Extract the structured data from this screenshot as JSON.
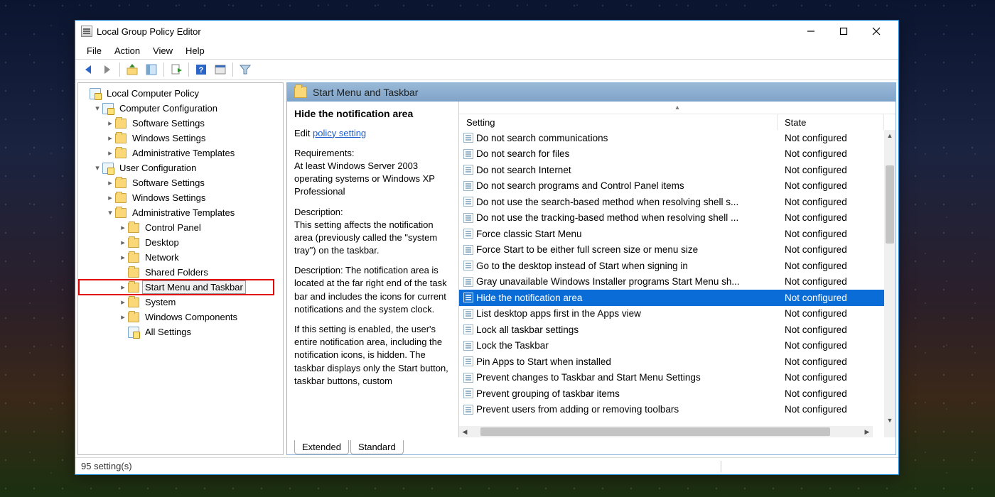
{
  "window": {
    "title": "Local Group Policy Editor"
  },
  "menu": {
    "file": "File",
    "action": "Action",
    "view": "View",
    "help": "Help"
  },
  "tree": {
    "root": "Local Computer Policy",
    "cc": "Computer Configuration",
    "cc_software": "Software Settings",
    "cc_windows": "Windows Settings",
    "cc_admin": "Administrative Templates",
    "uc": "User Configuration",
    "uc_software": "Software Settings",
    "uc_windows": "Windows Settings",
    "uc_admin": "Administrative Templates",
    "uc_cp": "Control Panel",
    "uc_desktop": "Desktop",
    "uc_network": "Network",
    "uc_shared": "Shared Folders",
    "uc_start": "Start Menu and Taskbar",
    "uc_system": "System",
    "uc_wincomp": "Windows Components",
    "uc_all": "All Settings"
  },
  "pane": {
    "header": "Start Menu and Taskbar",
    "desc_title": "Hide the notification area",
    "edit_prefix": "Edit ",
    "edit_link": "policy setting",
    "req_h": "Requirements:",
    "req_b": "At least Windows Server 2003 operating systems or Windows XP Professional",
    "d1_h": "Description:",
    "d1_b": "This setting affects the notification area (previously called the \"system tray\") on the taskbar.",
    "d2": "Description: The notification area is located at the far right end of the task bar and includes the icons for current notifications and the system clock.",
    "d3": "If this setting is enabled, the user's entire notification area, including the notification icons, is hidden. The taskbar displays only the Start button, taskbar buttons, custom"
  },
  "cols": {
    "setting": "Setting",
    "state": "State"
  },
  "settings": [
    {
      "name": "Do not search communications",
      "state": "Not configured"
    },
    {
      "name": "Do not search for files",
      "state": "Not configured"
    },
    {
      "name": "Do not search Internet",
      "state": "Not configured"
    },
    {
      "name": "Do not search programs and Control Panel items",
      "state": "Not configured"
    },
    {
      "name": "Do not use the search-based method when resolving shell s...",
      "state": "Not configured"
    },
    {
      "name": "Do not use the tracking-based method when resolving shell ...",
      "state": "Not configured"
    },
    {
      "name": "Force classic Start Menu",
      "state": "Not configured"
    },
    {
      "name": "Force Start to be either full screen size or menu size",
      "state": "Not configured"
    },
    {
      "name": "Go to the desktop instead of Start when signing in",
      "state": "Not configured"
    },
    {
      "name": "Gray unavailable Windows Installer programs Start Menu sh...",
      "state": "Not configured"
    },
    {
      "name": "Hide the notification area",
      "state": "Not configured",
      "selected": true
    },
    {
      "name": "List desktop apps first in the Apps view",
      "state": "Not configured"
    },
    {
      "name": "Lock all taskbar settings",
      "state": "Not configured"
    },
    {
      "name": "Lock the Taskbar",
      "state": "Not configured"
    },
    {
      "name": "Pin Apps to Start when installed",
      "state": "Not configured"
    },
    {
      "name": "Prevent changes to Taskbar and Start Menu Settings",
      "state": "Not configured"
    },
    {
      "name": "Prevent grouping of taskbar items",
      "state": "Not configured"
    },
    {
      "name": "Prevent users from adding or removing toolbars",
      "state": "Not configured"
    }
  ],
  "tabs": {
    "ext": "Extended",
    "std": "Standard"
  },
  "status": "95 setting(s)"
}
